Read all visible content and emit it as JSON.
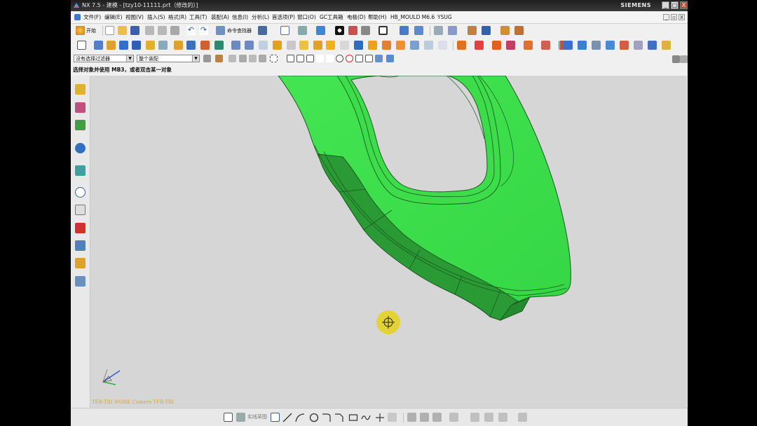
{
  "window": {
    "title": "NX 7.5 - 建模 - [tzy10-11111.prt（修改的）]",
    "brand": "SIEMENS",
    "min_label": "_",
    "max_label": "□",
    "close_label": "X"
  },
  "menu": {
    "items": [
      "文件(F)",
      "编辑(E)",
      "视图(V)",
      "插入(S)",
      "格式(R)",
      "工具(T)",
      "装配(A)",
      "信息(I)",
      "分析(L)",
      "首选项(P)",
      "窗口(O)",
      "GC工具箱",
      "电极(D)",
      "帮助(H)",
      "HB_MOULD M6.6",
      "YSUG"
    ],
    "mdi_buttons": [
      "_",
      "▫",
      "X"
    ]
  },
  "toolbar1": {
    "start_label": "开始",
    "command_finder_label": "命令查找器"
  },
  "selection_bar": {
    "filter_value": "没有选择过滤器",
    "scope_value": "整个装配"
  },
  "cue_line": "选择对象并使用 MB3，或者双击某一对象",
  "graphics": {
    "view_label": "TFR-TRI WORK Camera TFR-TRI",
    "model_color": "#3de04a",
    "background": "#d6d6d6"
  },
  "statusbar": {
    "sketch_label": "实线草图"
  }
}
